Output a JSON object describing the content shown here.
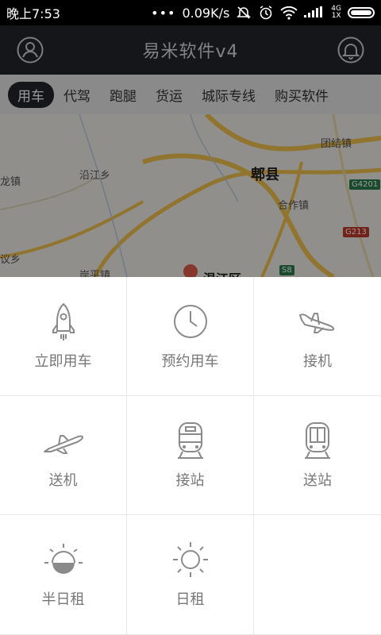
{
  "status": {
    "time": "晚上7:53",
    "speed": "0.09K/s",
    "net_top": "4G",
    "net_bottom": "1X",
    "icons": [
      "dots-icon",
      "mute-icon",
      "alarm-icon",
      "wifi-icon",
      "signal-icon",
      "battery-icon"
    ]
  },
  "header": {
    "title": "易米软件v4",
    "left_icon": "user-icon",
    "right_icon": "bell-icon"
  },
  "tabs": [
    {
      "label": "用车",
      "active": true
    },
    {
      "label": "代驾"
    },
    {
      "label": "跑腿"
    },
    {
      "label": "货运"
    },
    {
      "label": "城际专线"
    },
    {
      "label": "购买软件"
    }
  ],
  "map": {
    "labels": [
      "郫县",
      "团结镇",
      "沿江乡",
      "合作镇",
      "龙镇",
      "议乡",
      "岸平镇",
      "温江区"
    ],
    "shields": [
      "G4201",
      "G213",
      "S8"
    ]
  },
  "menu": [
    {
      "label": "立即用车",
      "icon": "rocket-icon"
    },
    {
      "label": "预约用车",
      "icon": "clock-icon"
    },
    {
      "label": "接机",
      "icon": "plane-landing-icon"
    },
    {
      "label": "送机",
      "icon": "plane-takeoff-icon"
    },
    {
      "label": "接站",
      "icon": "train-icon"
    },
    {
      "label": "送站",
      "icon": "metro-icon"
    },
    {
      "label": "半日租",
      "icon": "half-sun-icon"
    },
    {
      "label": "日租",
      "icon": "sun-icon"
    },
    {
      "label": "",
      "icon": ""
    }
  ],
  "colors": {
    "header_bg": "#22262c",
    "tab_bar_bg": "#e6e6e6",
    "active_tab_bg": "#22262c",
    "icon_gray": "#8a8a8a"
  }
}
